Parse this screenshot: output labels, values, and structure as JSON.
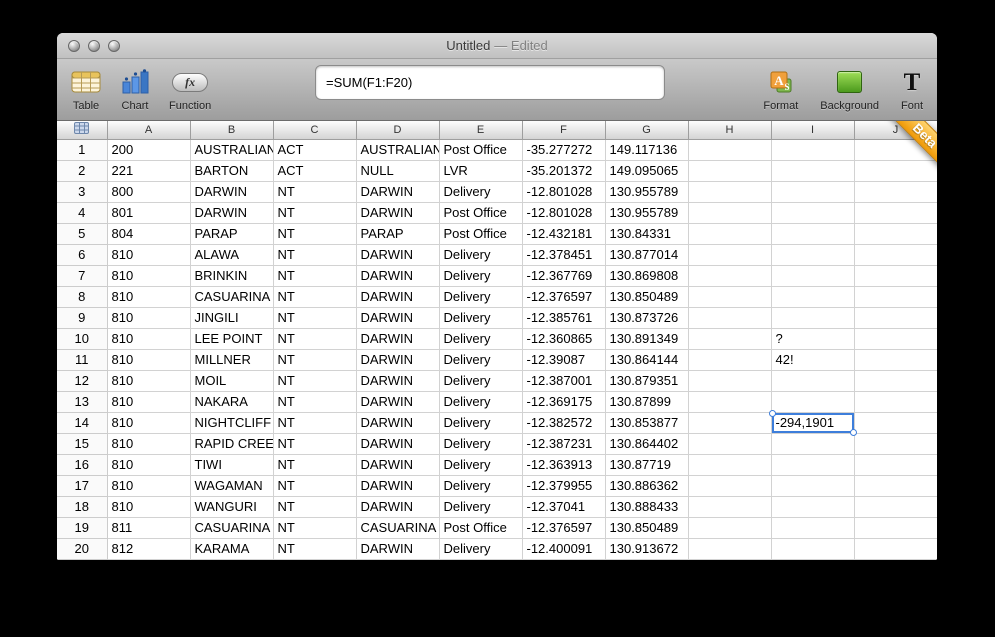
{
  "window": {
    "title": "Untitled",
    "title_suffix": "— Edited"
  },
  "toolbar": {
    "table_label": "Table",
    "chart_label": "Chart",
    "function_label": "Function",
    "function_glyph": "fx",
    "formula": "=SUM(F1:F20)",
    "format_label": "Format",
    "background_label": "Background",
    "font_label": "Font",
    "font_glyph": "T"
  },
  "beta_ribbon": "Beta",
  "colors": {
    "selection_border": "#3d7edb",
    "beta_ribbon": "#f09a06"
  },
  "spreadsheet": {
    "columns": [
      "A",
      "B",
      "C",
      "D",
      "E",
      "F",
      "G",
      "H",
      "I",
      "J"
    ],
    "selection": {
      "row": 14,
      "column": "I"
    },
    "rows": [
      {
        "n": 1,
        "cells": [
          "200",
          "AUSTRALIAN",
          "ACT",
          "AUSTRALIAN",
          "Post Office",
          "-35.277272",
          "149.117136",
          "",
          "",
          ""
        ]
      },
      {
        "n": 2,
        "cells": [
          "221",
          "BARTON",
          "ACT",
          "NULL",
          "LVR",
          "-35.201372",
          "149.095065",
          "",
          "",
          ""
        ]
      },
      {
        "n": 3,
        "cells": [
          "800",
          "DARWIN",
          "NT",
          "DARWIN",
          "Delivery",
          "-12.801028",
          "130.955789",
          "",
          "",
          ""
        ]
      },
      {
        "n": 4,
        "cells": [
          "801",
          "DARWIN",
          "NT",
          "DARWIN",
          "Post Office",
          "-12.801028",
          "130.955789",
          "",
          "",
          ""
        ]
      },
      {
        "n": 5,
        "cells": [
          "804",
          "PARAP",
          "NT",
          "PARAP",
          "Post Office",
          "-12.432181",
          "130.84331",
          "",
          "",
          ""
        ]
      },
      {
        "n": 6,
        "cells": [
          "810",
          "ALAWA",
          "NT",
          "DARWIN",
          "Delivery",
          "-12.378451",
          "130.877014",
          "",
          "",
          ""
        ]
      },
      {
        "n": 7,
        "cells": [
          "810",
          "BRINKIN",
          "NT",
          "DARWIN",
          "Delivery",
          "-12.367769",
          "130.869808",
          "",
          "",
          ""
        ]
      },
      {
        "n": 8,
        "cells": [
          "810",
          "CASUARINA",
          "NT",
          "DARWIN",
          "Delivery",
          "-12.376597",
          "130.850489",
          "",
          "",
          ""
        ]
      },
      {
        "n": 9,
        "cells": [
          "810",
          "JINGILI",
          "NT",
          "DARWIN",
          "Delivery",
          "-12.385761",
          "130.873726",
          "",
          "",
          ""
        ]
      },
      {
        "n": 10,
        "cells": [
          "810",
          "LEE POINT",
          "NT",
          "DARWIN",
          "Delivery",
          "-12.360865",
          "130.891349",
          "",
          "?",
          ""
        ]
      },
      {
        "n": 11,
        "cells": [
          "810",
          "MILLNER",
          "NT",
          "DARWIN",
          "Delivery",
          "-12.39087",
          "130.864144",
          "",
          "42!",
          ""
        ]
      },
      {
        "n": 12,
        "cells": [
          "810",
          "MOIL",
          "NT",
          "DARWIN",
          "Delivery",
          "-12.387001",
          "130.879351",
          "",
          "",
          ""
        ]
      },
      {
        "n": 13,
        "cells": [
          "810",
          "NAKARA",
          "NT",
          "DARWIN",
          "Delivery",
          "-12.369175",
          "130.87899",
          "",
          "",
          ""
        ]
      },
      {
        "n": 14,
        "cells": [
          "810",
          "NIGHTCLIFF",
          "NT",
          "DARWIN",
          "Delivery",
          "-12.382572",
          "130.853877",
          "",
          "-294,1901",
          ""
        ]
      },
      {
        "n": 15,
        "cells": [
          "810",
          "RAPID CREEK",
          "NT",
          "DARWIN",
          "Delivery",
          "-12.387231",
          "130.864402",
          "",
          "",
          ""
        ]
      },
      {
        "n": 16,
        "cells": [
          "810",
          "TIWI",
          "NT",
          "DARWIN",
          "Delivery",
          "-12.363913",
          "130.87719",
          "",
          "",
          ""
        ]
      },
      {
        "n": 17,
        "cells": [
          "810",
          "WAGAMAN",
          "NT",
          "DARWIN",
          "Delivery",
          "-12.379955",
          "130.886362",
          "",
          "",
          ""
        ]
      },
      {
        "n": 18,
        "cells": [
          "810",
          "WANGURI",
          "NT",
          "DARWIN",
          "Delivery",
          "-12.37041",
          "130.888433",
          "",
          "",
          ""
        ]
      },
      {
        "n": 19,
        "cells": [
          "811",
          "CASUARINA",
          "NT",
          "CASUARINA",
          "Post Office",
          "-12.376597",
          "130.850489",
          "",
          "",
          ""
        ]
      },
      {
        "n": 20,
        "cells": [
          "812",
          "KARAMA",
          "NT",
          "DARWIN",
          "Delivery",
          "-12.400091",
          "130.913672",
          "",
          "",
          ""
        ]
      }
    ]
  }
}
